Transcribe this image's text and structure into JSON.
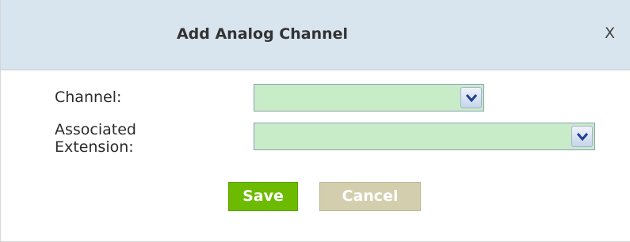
{
  "dialog": {
    "title": "Add Analog Channel",
    "close_label": "X"
  },
  "form": {
    "channel_label": "Channel:",
    "channel_value": "",
    "extension_label_line1": "Associated",
    "extension_label_line2": "Extension:",
    "extension_value": ""
  },
  "buttons": {
    "save_label": "Save",
    "cancel_label": "Cancel"
  },
  "icons": {
    "dropdown": "chevron-down-icon",
    "close": "close-icon"
  },
  "colors": {
    "titlebar": "#d8e4ee",
    "select_fill": "#c8ecc8",
    "save": "#6cbb00",
    "cancel": "#d3cfae"
  }
}
